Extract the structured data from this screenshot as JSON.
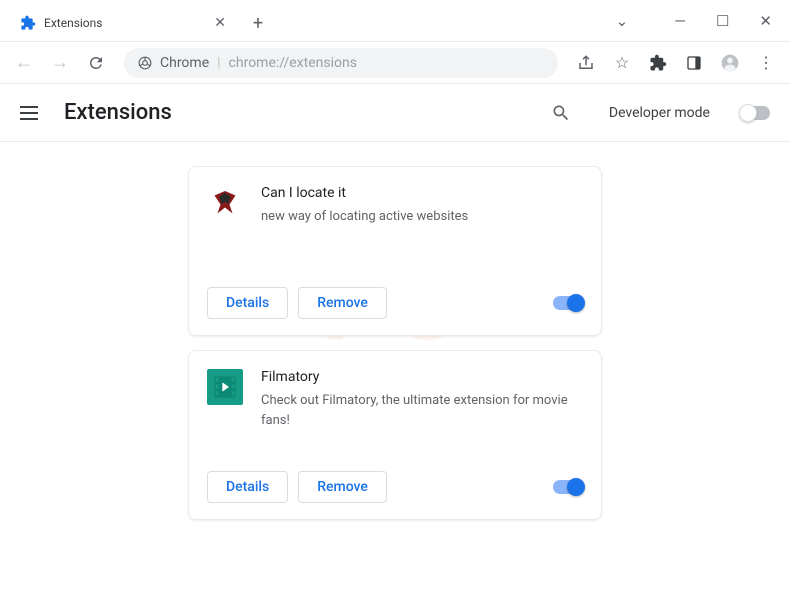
{
  "window": {
    "tab_title": "Extensions"
  },
  "omnibox": {
    "scheme_label": "Chrome",
    "url_path": "chrome://extensions"
  },
  "header": {
    "title": "Extensions",
    "developer_mode_label": "Developer mode",
    "developer_mode_on": false
  },
  "buttons": {
    "details": "Details",
    "remove": "Remove"
  },
  "extensions": [
    {
      "name": "Can I locate it",
      "description": "new way of locating active websites",
      "enabled": true,
      "icon": "phoenix"
    },
    {
      "name": "Filmatory",
      "description": "Check out Filmatory, the ultimate extension for movie fans!",
      "enabled": true,
      "icon": "film"
    }
  ]
}
